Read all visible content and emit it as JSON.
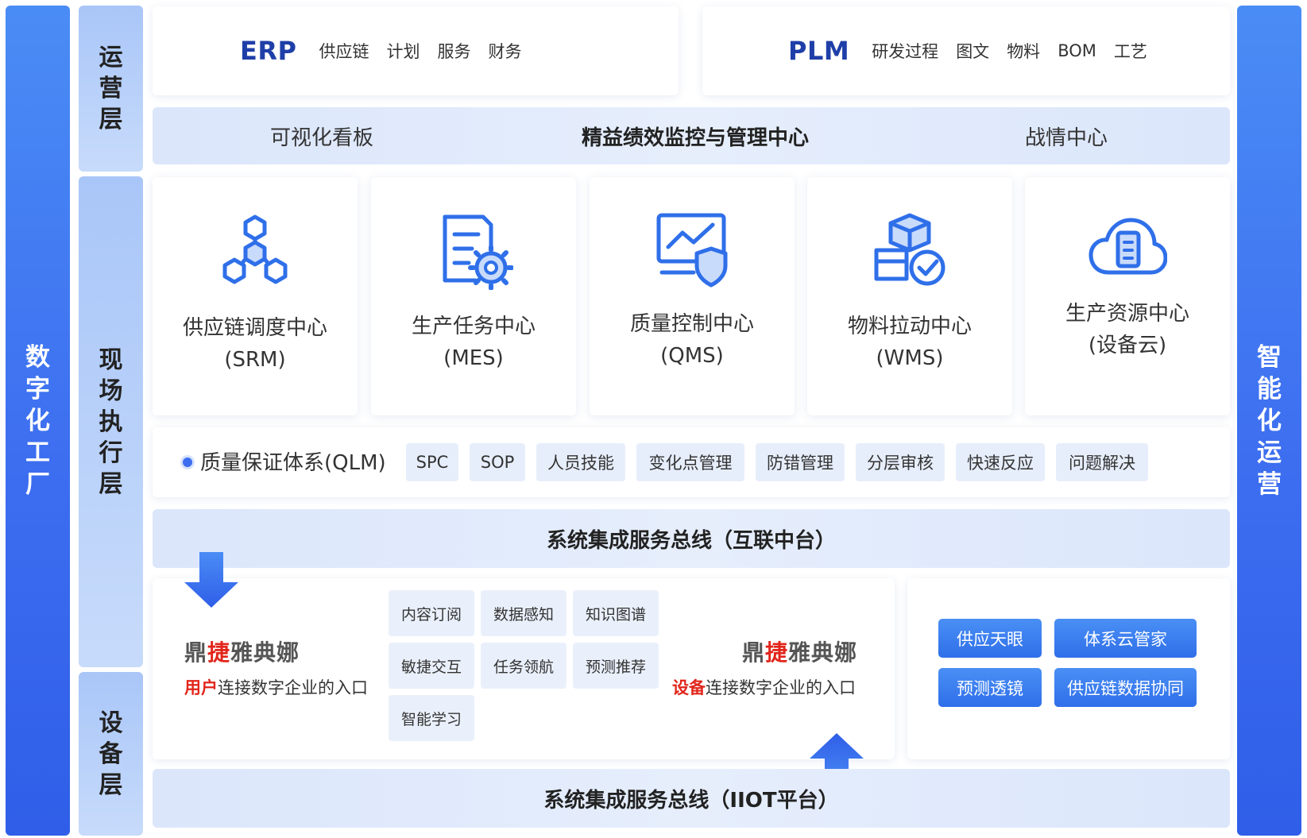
{
  "left_bar": {
    "label": [
      "数",
      "字",
      "化",
      "工",
      "厂"
    ]
  },
  "right_bar": {
    "label": [
      "智",
      "能",
      "化",
      "运",
      "营"
    ]
  },
  "layers": {
    "operation": [
      "运",
      "营",
      "层"
    ],
    "execution": [
      "现",
      "场",
      "执",
      "行",
      "层"
    ],
    "equipment": [
      "设",
      "备",
      "层"
    ]
  },
  "erp": {
    "name": "ERP",
    "items": [
      "供应链",
      "计划",
      "服务",
      "财务"
    ]
  },
  "plm": {
    "name": "PLM",
    "items": [
      "研发过程",
      "图文",
      "物料",
      "BOM",
      "工艺"
    ]
  },
  "monitor_band": {
    "left": "可视化看板",
    "center": "精益绩效监控与管理中心",
    "right": "战情中心"
  },
  "modules": [
    {
      "line1": "供应链调度中心",
      "line2": "(SRM)",
      "icon": "supply-chain-network-icon"
    },
    {
      "line1": "生产任务中心",
      "line2": "(MES)",
      "icon": "production-task-icon"
    },
    {
      "line1": "质量控制中心",
      "line2": "(QMS)",
      "icon": "quality-control-icon"
    },
    {
      "line1": "物料拉动中心",
      "line2": "(WMS)",
      "icon": "material-pull-icon"
    },
    {
      "line1": "生产资源中心",
      "line2": "(设备云)",
      "icon": "device-cloud-icon"
    }
  ],
  "qlm": {
    "title": "质量保证体系(QLM)",
    "tags": [
      "SPC",
      "SOP",
      "人员技能",
      "变化点管理",
      "防错管理",
      "分层审核",
      "快速反应",
      "问题解决"
    ]
  },
  "bus_top": "系统集成服务总线（互联中台）",
  "bus_bottom": "系统集成服务总线（IIOT平台）",
  "platform": {
    "logo_parts": [
      "鼎",
      "捷",
      "雅典娜"
    ],
    "user_entry": {
      "prefix": "用户",
      "text": "连接数字企业的入口"
    },
    "device_entry": {
      "prefix": "设备",
      "text": "连接数字企业的入口"
    },
    "features": [
      "内容订阅",
      "数据感知",
      "知识图谱",
      "敏捷交互",
      "任务领航",
      "预测推荐",
      "智能学习"
    ]
  },
  "buttons": [
    "供应天眼",
    "体系云管家",
    "预测透镜",
    "供应链数据协同"
  ],
  "colors": {
    "primary_blue": "#3d6ef0",
    "accent_red": "#e1251b",
    "title_blue": "#1f3fa8"
  }
}
